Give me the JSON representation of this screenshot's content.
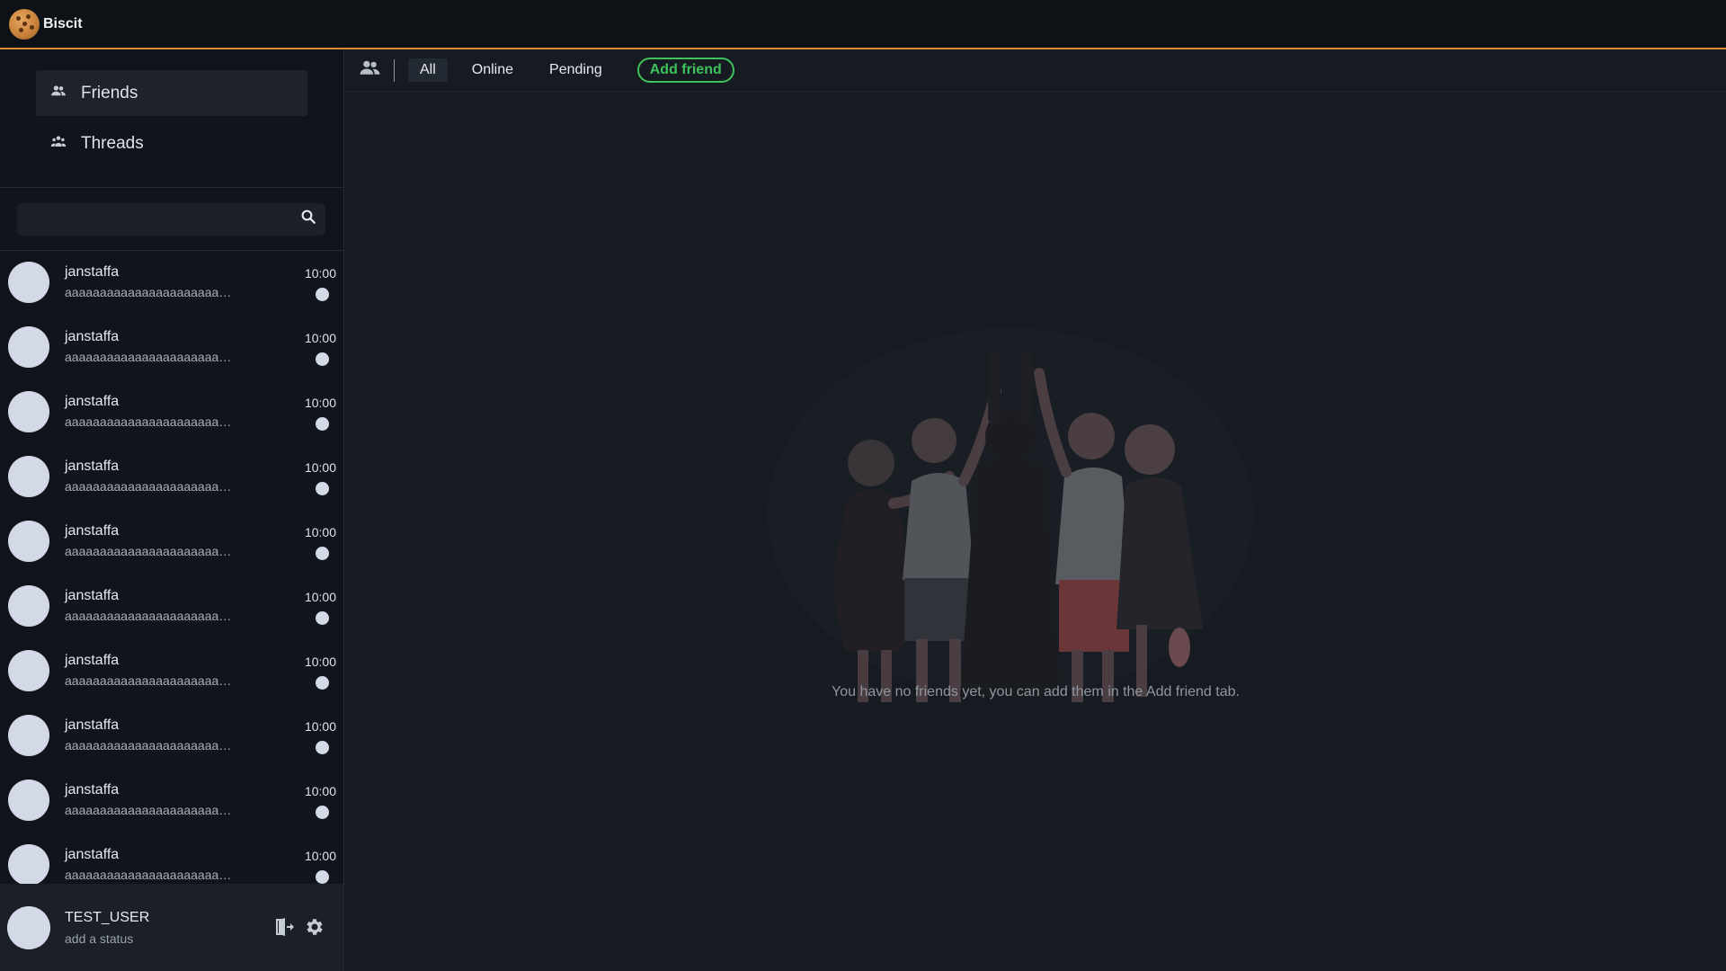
{
  "app": {
    "title": "Biscit",
    "logo_icon": "cookie-icon"
  },
  "sidebar": {
    "nav": [
      {
        "label": "Friends",
        "icon": "friends-icon",
        "active": true
      },
      {
        "label": "Threads",
        "icon": "threads-icon",
        "active": false
      }
    ],
    "search": {
      "placeholder": "",
      "value": ""
    },
    "chats": [
      {
        "name": "janstaffa",
        "preview": "aaaaaaaaaaaaaaaaaaaaaaaaaaaaaa",
        "time": "10:00"
      },
      {
        "name": "janstaffa",
        "preview": "aaaaaaaaaaaaaaaaaaaaaaaaaaaaaa",
        "time": "10:00"
      },
      {
        "name": "janstaffa",
        "preview": "aaaaaaaaaaaaaaaaaaaaaaaaaaaaaa",
        "time": "10:00"
      },
      {
        "name": "janstaffa",
        "preview": "aaaaaaaaaaaaaaaaaaaaaaaaaaaaaa",
        "time": "10:00"
      },
      {
        "name": "janstaffa",
        "preview": "aaaaaaaaaaaaaaaaaaaaaaaaaaaaaa",
        "time": "10:00"
      },
      {
        "name": "janstaffa",
        "preview": "aaaaaaaaaaaaaaaaaaaaaaaaaaaaaa",
        "time": "10:00"
      },
      {
        "name": "janstaffa",
        "preview": "aaaaaaaaaaaaaaaaaaaaaaaaaaaaaa",
        "time": "10:00"
      },
      {
        "name": "janstaffa",
        "preview": "aaaaaaaaaaaaaaaaaaaaaaaaaaaaaa",
        "time": "10:00"
      },
      {
        "name": "janstaffa",
        "preview": "aaaaaaaaaaaaaaaaaaaaaaaaaaaaaa",
        "time": "10:00"
      },
      {
        "name": "janstaffa",
        "preview": "aaaaaaaaaaaaaaaaaaaaaaaaaaaaaa",
        "time": "10:00"
      }
    ]
  },
  "user": {
    "name": "TEST_USER",
    "status": "add a status",
    "logout_icon": "logout-icon",
    "settings_icon": "gear-icon"
  },
  "tabs": {
    "items": [
      {
        "label": "All",
        "active": true
      },
      {
        "label": "Online",
        "active": false
      },
      {
        "label": "Pending",
        "active": false
      }
    ],
    "add_friend": "Add friend"
  },
  "main": {
    "empty_message": "You have no friends yet, you can add them in the Add friend tab."
  },
  "colors": {
    "accent_orange": "#d98e35",
    "add_friend_green": "#3ec15a",
    "avatar": "#d3d9e7"
  }
}
